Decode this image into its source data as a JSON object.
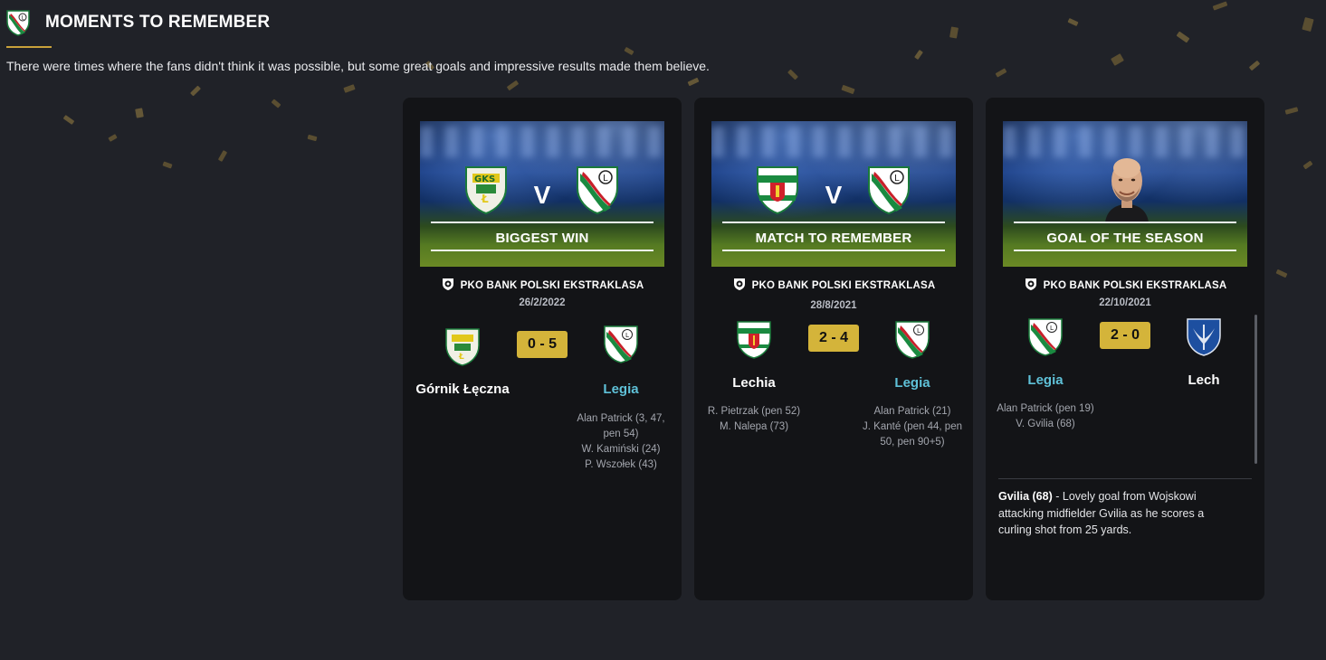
{
  "header": {
    "title": "MOMENTS TO REMEMBER",
    "subtitle": "There were times where the fans didn't think it was possible, but some great goals and impressive results made them believe.",
    "club_icon": "legia-crest-icon"
  },
  "colors": {
    "background": "#202228",
    "card": "#131417",
    "accent_gold": "#d4b43a",
    "highlight_team": "#5fc1d8"
  },
  "cards": [
    {
      "banner_label": "BIGGEST WIN",
      "banner_v": "V",
      "competition": "PKO BANK POLSKI EKSTRAKLASA",
      "date": "26/2/2022",
      "home_team": "Górnik Łęczna",
      "away_team": "Legia",
      "score": "0 - 5",
      "home_scorers": [],
      "away_scorers": [
        "Alan Patrick (3, 47, pen 54)",
        "W. Kamiński (24)",
        "P. Wszołek (43)"
      ]
    },
    {
      "banner_label": "MATCH TO REMEMBER",
      "banner_v": "V",
      "competition": "PKO BANK POLSKI EKSTRAKLASA",
      "date": "28/8/2021",
      "home_team": "Lechia",
      "away_team": "Legia",
      "score": "2 - 4",
      "home_scorers": [
        "R. Pietrzak (pen 52)",
        "M. Nalepa (73)"
      ],
      "away_scorers": [
        "Alan Patrick (21)",
        "J. Kanté (pen 44, pen 50, pen 90+5)"
      ]
    },
    {
      "banner_label": "GOAL OF THE SEASON",
      "competition": "PKO BANK POLSKI EKSTRAKLASA",
      "date": "22/10/2021",
      "home_team": "Legia",
      "away_team": "Lech",
      "score": "2 - 0",
      "home_scorers": [
        "Alan Patrick (pen 19)",
        "V. Gvilia (68)"
      ],
      "away_scorers": [],
      "goal_title": "Gvilia (68)",
      "goal_text": "- Lovely goal from Wojskowi attacking midfielder Gvilia as he scores a curling shot from 25 yards."
    }
  ]
}
